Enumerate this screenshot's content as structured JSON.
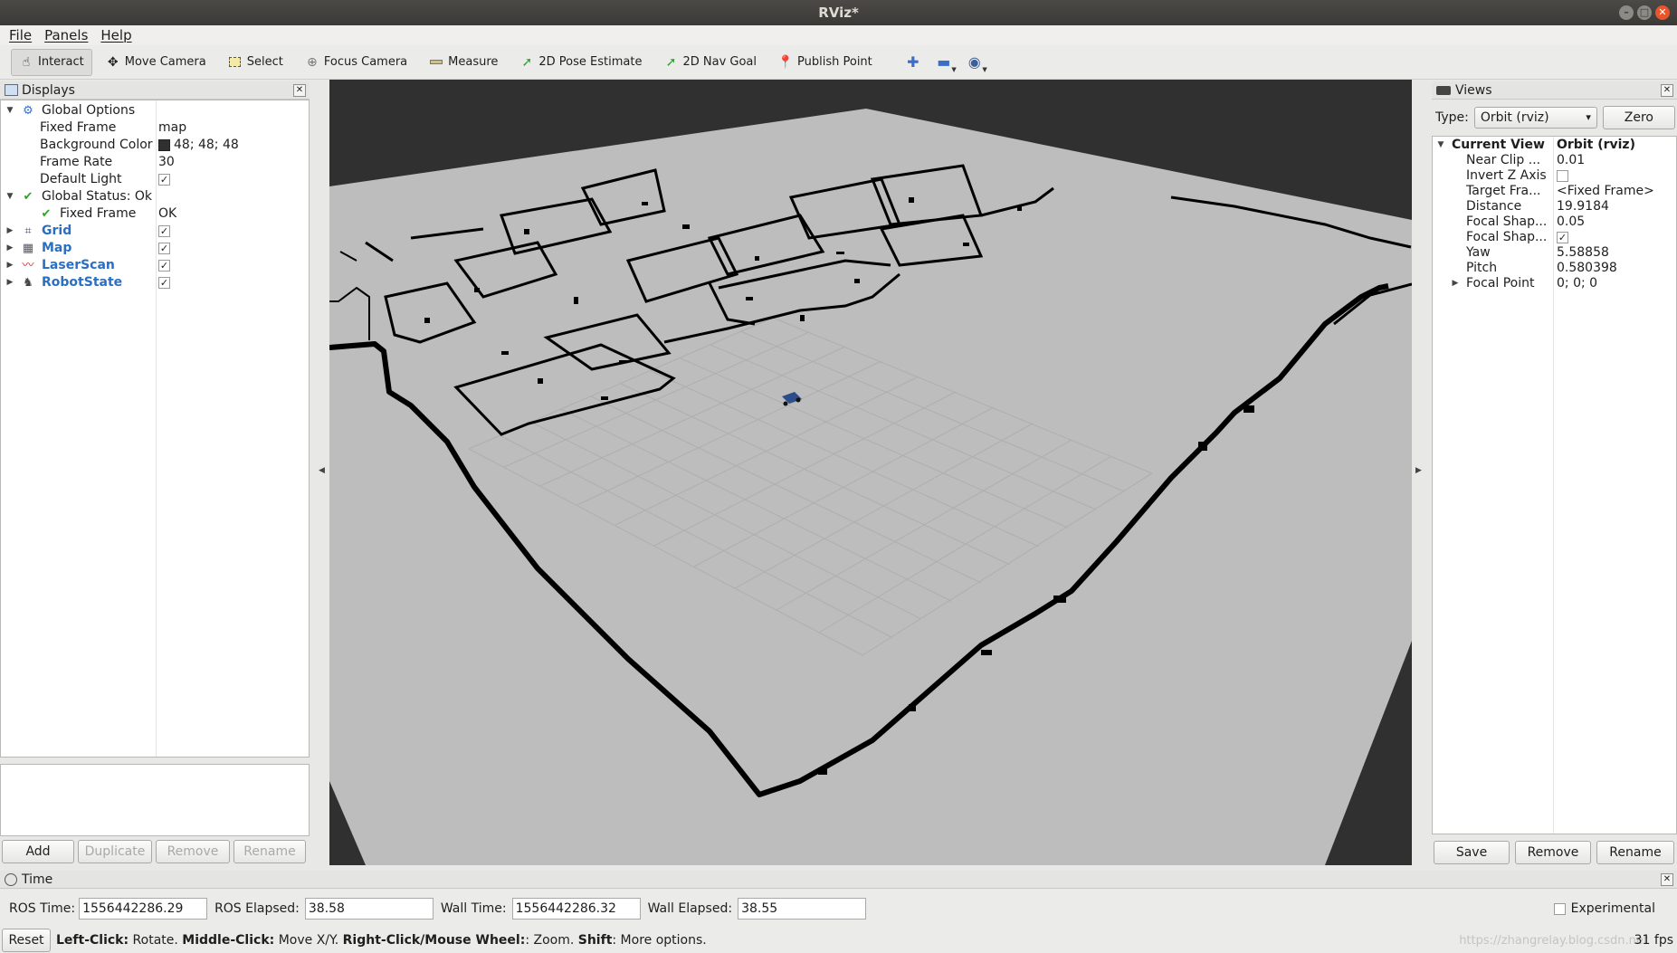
{
  "window": {
    "title": "RViz*"
  },
  "menu": [
    "File",
    "Panels",
    "Help"
  ],
  "toolbar": {
    "tools": [
      "Interact",
      "Move Camera",
      "Select",
      "Focus Camera",
      "Measure",
      "2D Pose Estimate",
      "2D Nav Goal",
      "Publish Point"
    ]
  },
  "displays": {
    "title": "Displays",
    "global_options": {
      "label": "Global Options",
      "fixed_frame_label": "Fixed Frame",
      "fixed_frame": "map",
      "background_color_label": "Background Color",
      "background_color": "48; 48; 48",
      "frame_rate_label": "Frame Rate",
      "frame_rate": "30",
      "default_light_label": "Default Light",
      "default_light": true
    },
    "global_status": {
      "label": "Global Status: Ok",
      "child_label": "Fixed Frame",
      "child_value": "OK"
    },
    "items": [
      {
        "label": "Grid",
        "checked": true
      },
      {
        "label": "Map",
        "checked": true
      },
      {
        "label": "LaserScan",
        "checked": true
      },
      {
        "label": "RobotState",
        "checked": true
      }
    ],
    "buttons": {
      "add": "Add",
      "duplicate": "Duplicate",
      "remove": "Remove",
      "rename": "Rename"
    }
  },
  "views": {
    "title": "Views",
    "type_label": "Type:",
    "type_value": "Orbit (rviz)",
    "zero_label": "Zero",
    "current_view_label": "Current View",
    "current_view_value": "Orbit (rviz)",
    "props": [
      {
        "label": "Near Clip ...",
        "value": "0.01"
      },
      {
        "label": "Invert Z Axis",
        "value": "",
        "checkbox": false
      },
      {
        "label": "Target Fra...",
        "value": "<Fixed Frame>"
      },
      {
        "label": "Distance",
        "value": "19.9184"
      },
      {
        "label": "Focal Shap...",
        "value": "0.05"
      },
      {
        "label": "Focal Shap...",
        "value": "",
        "checkbox": true
      },
      {
        "label": "Yaw",
        "value": "5.58858"
      },
      {
        "label": "Pitch",
        "value": "0.580398"
      },
      {
        "label": "Focal Point",
        "value": "0; 0; 0"
      }
    ],
    "buttons": {
      "save": "Save",
      "remove": "Remove",
      "rename": "Rename"
    }
  },
  "time": {
    "title": "Time",
    "ros_time_label": "ROS Time:",
    "ros_time": "1556442286.29",
    "ros_elapsed_label": "ROS Elapsed:",
    "ros_elapsed": "38.58",
    "wall_time_label": "Wall Time:",
    "wall_time": "1556442286.32",
    "wall_elapsed_label": "Wall Elapsed:",
    "wall_elapsed": "38.55",
    "experimental_label": "Experimental",
    "reset_label": "Reset",
    "help": {
      "left_click": "Left-Click:",
      "left_click_text": " Rotate. ",
      "middle_click": "Middle-Click:",
      "middle_click_text": " Move X/Y. ",
      "right_click": "Right-Click/Mouse Wheel:",
      "right_click_text": ": Zoom. ",
      "shift": "Shift",
      "shift_text": ": More options."
    },
    "fps": "31 fps"
  },
  "watermark": "https://zhangrelay.blog.csdn.net",
  "colors": {
    "background": "#303030",
    "map_free": "#bdbdbd",
    "map_occupied": "#000000",
    "robot": "#2c4f8c",
    "accent_blue": "#2a6fc2"
  }
}
